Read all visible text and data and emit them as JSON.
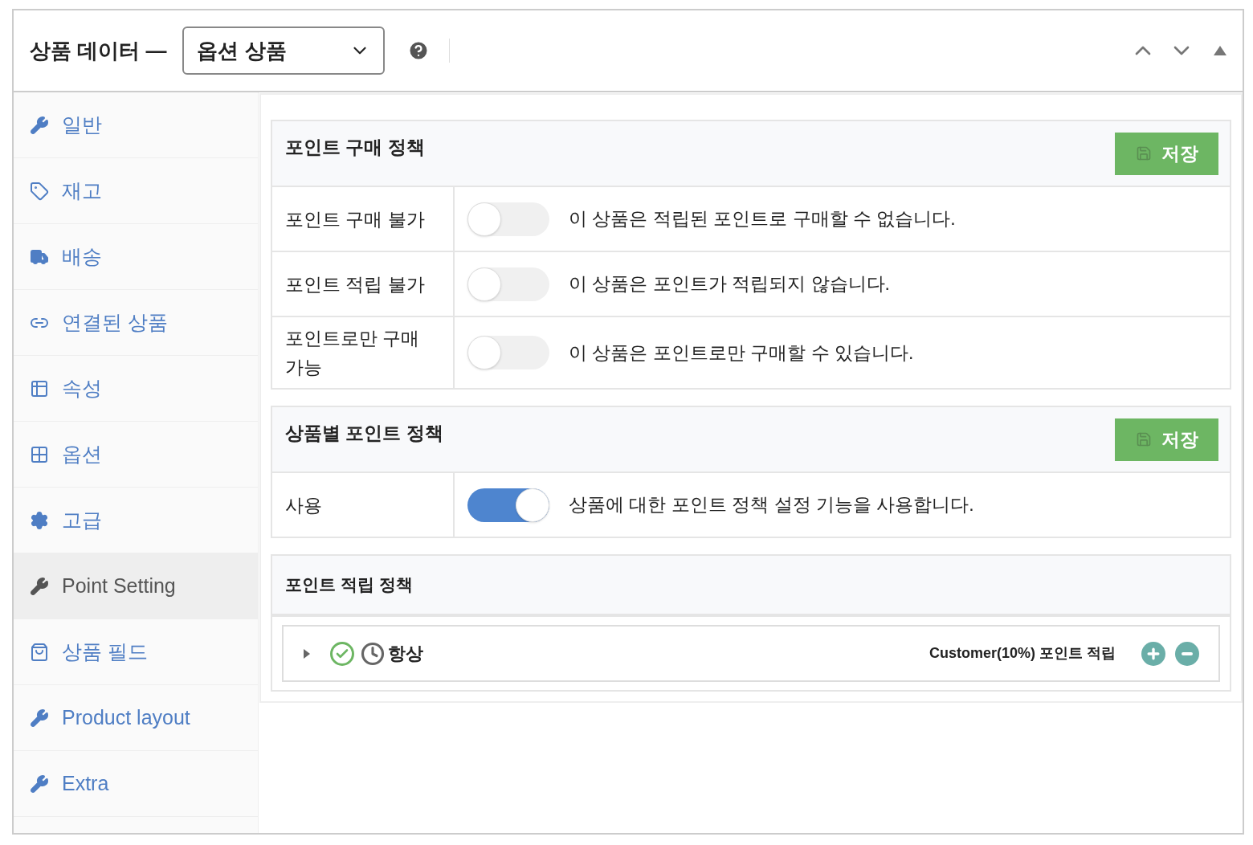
{
  "header": {
    "title": "상품 데이터 —",
    "product_type": {
      "value": "옵션 상품"
    }
  },
  "sidebar": {
    "items": [
      {
        "label": "일반",
        "selected": false
      },
      {
        "label": "재고",
        "selected": false
      },
      {
        "label": "배송",
        "selected": false
      },
      {
        "label": "연결된 상품",
        "selected": false
      },
      {
        "label": "속성",
        "selected": false
      },
      {
        "label": "옵션",
        "selected": false
      },
      {
        "label": "고급",
        "selected": false
      },
      {
        "label": "Point Setting",
        "selected": true
      },
      {
        "label": "상품 필드",
        "selected": false
      },
      {
        "label": "Product layout",
        "selected": false
      },
      {
        "label": "Extra",
        "selected": false
      }
    ]
  },
  "sections": [
    {
      "title": "포인트 구매 정책",
      "save_button": "저장",
      "rows": [
        {
          "label": "포인트 구매 불가",
          "on": false,
          "description": "이 상품은 적립된 포인트로 구매할 수 없습니다."
        },
        {
          "label": "포인트 적립 불가",
          "on": false,
          "description": "이 상품은 포인트가 적립되지 않습니다."
        },
        {
          "label": "포인트로만 구매 가능",
          "on": false,
          "description": "이 상품은 포인트로만 구매할 수 있습니다."
        }
      ]
    },
    {
      "title": "상품별 포인트 정책",
      "save_button": "저장",
      "rows": [
        {
          "label": "사용",
          "on": true,
          "description": "상품에 대한 포인트 정책 설정 기능을 사용합니다."
        }
      ]
    }
  ],
  "earning_policy": {
    "title": "포인트 적립 정책",
    "rules": [
      {
        "expanded": false,
        "active": true,
        "name": "항상",
        "summary": "Customer(10%) 포인트 적립"
      }
    ]
  }
}
